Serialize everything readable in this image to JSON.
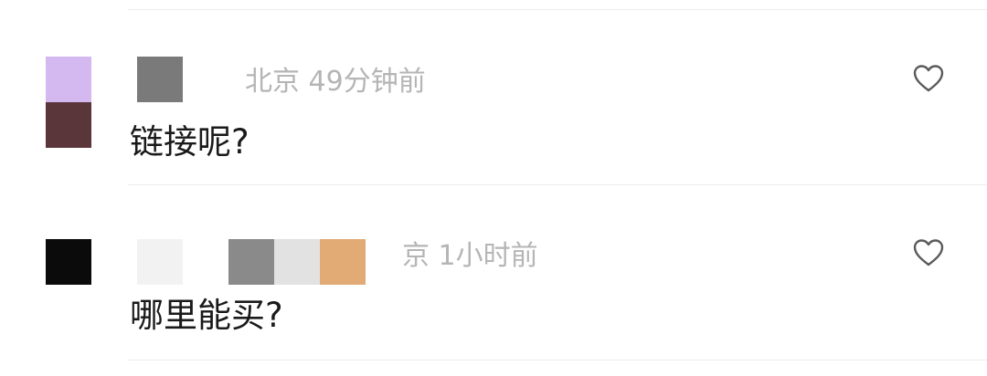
{
  "comments": [
    {
      "author_meta": "北京 49分钟前",
      "text": "链接呢?"
    },
    {
      "author_meta": "京 1小时前",
      "text": "哪里能买?"
    }
  ],
  "icons": {
    "like": "heart-outline-icon"
  },
  "colors": {
    "meta_text": "#b5b5b5",
    "comment_text": "#1a1a1a",
    "divider": "#ececec"
  }
}
